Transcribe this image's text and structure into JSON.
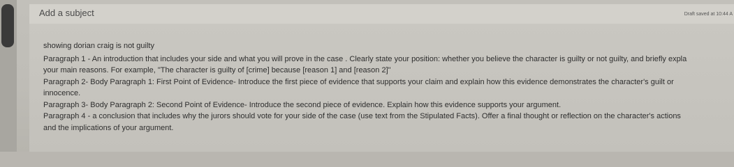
{
  "compose": {
    "subject_placeholder": "Add a subject",
    "draft_status": "Draft saved at 10:44 A"
  },
  "body": {
    "summary": "showing dorian craig is not guilty",
    "paragraphs": [
      {
        "line1": "Paragraph 1 - An introduction that includes your side and what you will prove in the case . Clearly state your position: whether you believe the character is guilty or not guilty, and briefly expla",
        "line2": "your main reasons. For example, \"The character is guilty of [crime] because [reason 1] and [reason 2]\""
      },
      {
        "line1": "Paragraph 2- Body Paragraph 1: First Point of Evidence- Introduce the first piece of evidence that supports your claim and explain how this evidence demonstrates the character's guilt or",
        "line2": "innocence."
      },
      {
        "line1": "Paragraph 3- Body Paragraph 2: Second Point of Evidence- Introduce the second piece of evidence.  Explain how this evidence supports your argument."
      },
      {
        "line1": "Paragraph 4 - a conclusion that includes why the jurors should vote for your side of the case (use text from the Stipulated Facts).  Offer a final thought or reflection on the character's actions",
        "line2": "and the implications of your argument."
      }
    ]
  }
}
